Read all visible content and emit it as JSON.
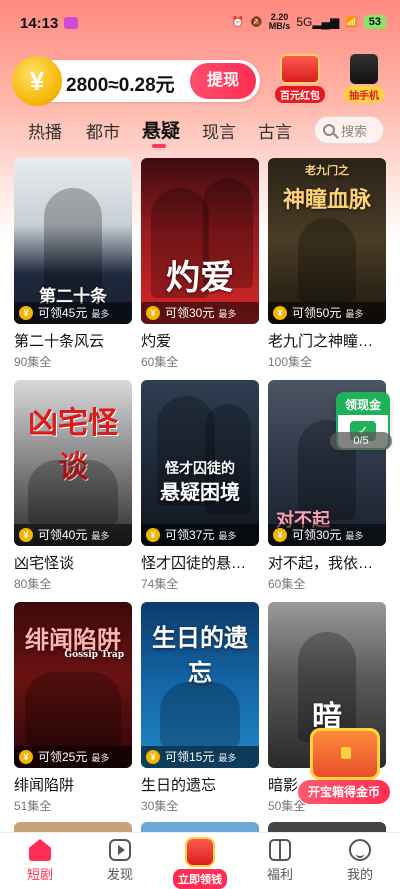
{
  "status": {
    "time": "14:13",
    "net_speed": "2.20",
    "net_unit": "MB/s",
    "net_type": "5G",
    "battery": "53"
  },
  "coins": {
    "text": "2800≈0.28元",
    "coin_symbol": "¥",
    "withdraw_label": "提现"
  },
  "promos": {
    "redpack_label": "百元红包",
    "phone_label": "抽手机"
  },
  "tabs": [
    "热播",
    "都市",
    "悬疑",
    "现言",
    "古言"
  ],
  "active_tab": "悬疑",
  "search": {
    "placeholder": "搜索"
  },
  "dramas": [
    {
      "title": "第二十条风云",
      "episodes": "90集全",
      "reward": "可领45元",
      "most": "最多",
      "poster_text": "第二十条"
    },
    {
      "title": "灼爱",
      "episodes": "60集全",
      "reward": "可领30元",
      "most": "最多",
      "poster_text": "灼爱"
    },
    {
      "title": "老九门之神瞳…",
      "episodes": "100集全",
      "reward": "可领50元",
      "most": "最多",
      "poster_text": "神瞳血脉",
      "poster_sub": "老九门之"
    },
    {
      "title": "凶宅怪谈",
      "episodes": "80集全",
      "reward": "可领40元",
      "most": "最多",
      "poster_text": "凶宅怪谈"
    },
    {
      "title": "怪才囚徒的悬…",
      "episodes": "74集全",
      "reward": "可领37元",
      "most": "最多",
      "poster_text": "悬疑困境",
      "poster_sub": "怪才囚徒的"
    },
    {
      "title": "对不起，我依…",
      "episodes": "60集全",
      "reward": "可领30元",
      "most": "最多",
      "poster_text": "对不起"
    },
    {
      "title": "绯闻陷阱",
      "episodes": "51集全",
      "reward": "可领25元",
      "most": "最多",
      "poster_text": "绯闻陷阱",
      "poster_sub": "Gossip Trap"
    },
    {
      "title": "生日的遗忘",
      "episodes": "30集全",
      "reward": "可领15元",
      "most": "最多",
      "poster_text": "生日的遗忘"
    },
    {
      "title": "暗影…",
      "episodes": "50集全",
      "reward": "",
      "most": "",
      "poster_text": "暗"
    }
  ],
  "floating": {
    "task_label": "领现金",
    "progress": "0/5",
    "chest_label": "开宝箱得金币"
  },
  "nav": {
    "home": "短剧",
    "discover": "发现",
    "center": "立即领钱",
    "welfare": "福利",
    "mine": "我的"
  },
  "colors": {
    "accent": "#ff2e52",
    "coin": "#f5b400",
    "task_green": "#20b25a"
  }
}
